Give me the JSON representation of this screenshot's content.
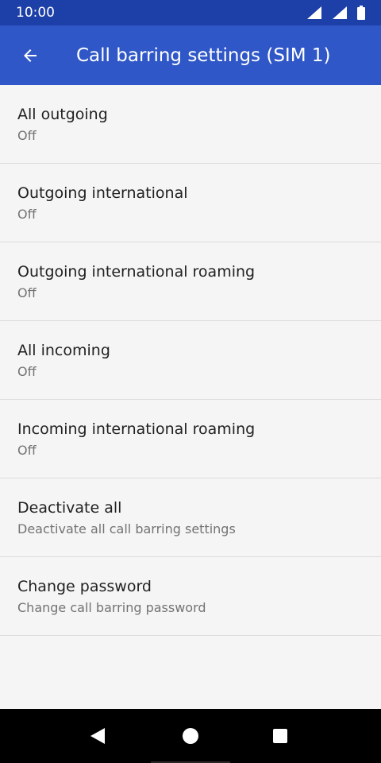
{
  "status_bar": {
    "time": "10:00",
    "icons": [
      "wifi-signal-icon",
      "cell-signal-icon",
      "battery-icon"
    ]
  },
  "app_bar": {
    "back_icon": "arrow-back-icon",
    "title": "Call barring settings (SIM 1)"
  },
  "colors": {
    "status_bar": "#1d3fa8",
    "app_bar": "#2f57c7",
    "background": "#f5f5f5"
  },
  "items": [
    {
      "title": "All outgoing",
      "summary": "Off"
    },
    {
      "title": "Outgoing international",
      "summary": "Off"
    },
    {
      "title": "Outgoing international roaming",
      "summary": "Off"
    },
    {
      "title": "All incoming",
      "summary": "Off"
    },
    {
      "title": "Incoming international roaming",
      "summary": "Off"
    },
    {
      "title": "Deactivate all",
      "summary": "Deactivate all call barring settings"
    },
    {
      "title": "Change password",
      "summary": "Change call barring password"
    }
  ],
  "nav_bar": {
    "icons": [
      "nav-back-icon",
      "nav-home-icon",
      "nav-recents-icon"
    ]
  }
}
